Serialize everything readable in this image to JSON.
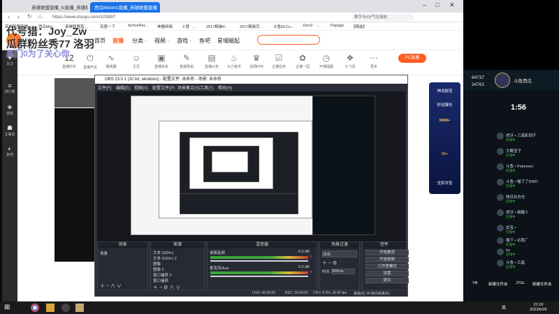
{
  "browser": {
    "tabs": [
      "英雄联盟直播_lo直播_英雄联盟",
      "西瓜Melon1直播_英雄联盟直播"
    ],
    "window_controls": [
      "–",
      "□",
      "✕"
    ],
    "url": "https://www.douyu.com/103997",
    "search_placeholder": "数字专6分气压接放",
    "bookmarks": [
      "英雄联盟直播",
      "西瓜Mel...",
      "英雄联盟直...",
      "百度一下",
      "duYuoRe(...",
      "神器网络",
      "3 登 · ...",
      "2017精装P...",
      "2017精装页...",
      "斗鱼DLCo...",
      "ZeroZ · ...",
      "Papago",
      "【精选】"
    ]
  },
  "douyu": {
    "nav": [
      "首页",
      "直播",
      "分类 ·",
      "视频 ·",
      "游戏 ·",
      "鱼吧",
      "星域崛起"
    ],
    "toolbar": [
      {
        "label": "12",
        "sub": "直播时长"
      },
      {
        "label": "直播开关"
      },
      {
        "label": "播放器"
      },
      {
        "label": "主页"
      },
      {
        "label": "直播信息"
      },
      {
        "label": "直播发帖"
      },
      {
        "label": "直播公告"
      },
      {
        "label": "大力金币"
      },
      {
        "label": "全网KPK"
      },
      {
        "label": "主播任务"
      },
      {
        "label": "主播一园"
      },
      {
        "label": "开播提醒"
      },
      {
        "label": "小飞龙"
      },
      {
        "label": "更多"
      }
    ],
    "pc_button": "PC直播",
    "overlay_lines": [
      "代号猎：Joy_Zw",
      "瓜群粉丝秀77 洛羽",
      "瓜门0为了关心你"
    ],
    "side": [
      "关注",
      "排行榜",
      "游戏",
      "主播巡",
      "鱼吧"
    ],
    "ad": [
      "神龙秘宝",
      "好运爆仓",
      "5000+",
      "99+",
      "全民夺宝"
    ]
  },
  "obs": {
    "title": "OBS 23.0.1 (32 bit, windows) - 配置文件: 未命名 - 场景: 未命名",
    "menu": [
      "文件(F)",
      "编辑(E)",
      "视图(V)",
      "配置文件(P)",
      "场景集合(S)",
      "工具(T)",
      "帮助(H)"
    ],
    "docks": {
      "scenes": {
        "title": "场景",
        "items": [
          "场景"
        ]
      },
      "sources": {
        "title": "来源",
        "items": [
          "文本 (GDI+)",
          "文本 (GDI+) 2",
          "图像",
          "图像 2",
          "窗口捕获 2",
          "窗口捕获"
        ]
      },
      "mixer": {
        "title": "混音器",
        "tracks": [
          {
            "name": "桌面音频",
            "db": "0.0 dB"
          },
          {
            "name": "麦克风/Aux",
            "db": "0.0 dB"
          }
        ]
      },
      "transitions": {
        "title": "场景过渡",
        "type": "淡出",
        "duration_label": "时长",
        "duration": "300ms"
      },
      "controls": {
        "title": "控件",
        "buttons": [
          "开始推流",
          "开始录制",
          "工作室模式",
          "设置",
          "退出"
        ]
      }
    },
    "status": [
      "LIVE: 00:00:00",
      "REC: 00:00:00",
      "CPU: 9.3%, 30.00 fps",
      "丢帧(在 30 帧内帧丢失)"
    ]
  },
  "right_panel": {
    "stats": [
      "64737",
      "34761"
    ],
    "name": "斗鱼西瓜",
    "timer": "1:56",
    "chat": [
      {
        "name": "虎牙 • 三森影回子",
        "sub": "在线中"
      },
      {
        "name": "大鲲宝子",
        "sub": "在线中"
      },
      {
        "name": "斗鱼 • Pokemon",
        "sub": "在线中"
      },
      {
        "name": "斗鱼 • 喵下了DWO",
        "sub": "在线中"
      },
      {
        "name": "咪目玩仓仓",
        "sub": "在线中"
      },
      {
        "name": "虎牙 • 姚鲲人",
        "sub": "在线中"
      },
      {
        "name": "武宝 •",
        "sub": "在线中"
      },
      {
        "name": "喵下 • 必胜厂",
        "sub": "在线中"
      },
      {
        "name": "tiu",
        "sub": "在线中"
      },
      {
        "name": "斗鱼 • 兰晶",
        "sub": "在线中"
      }
    ],
    "desktop_labels": [
      "YB",
      "新建文件夹",
      "JTGL",
      "新建文件夹"
    ]
  },
  "taskbar": {
    "clock_time": "21:10",
    "clock_date": "2022/6/26",
    "tray": "英"
  }
}
